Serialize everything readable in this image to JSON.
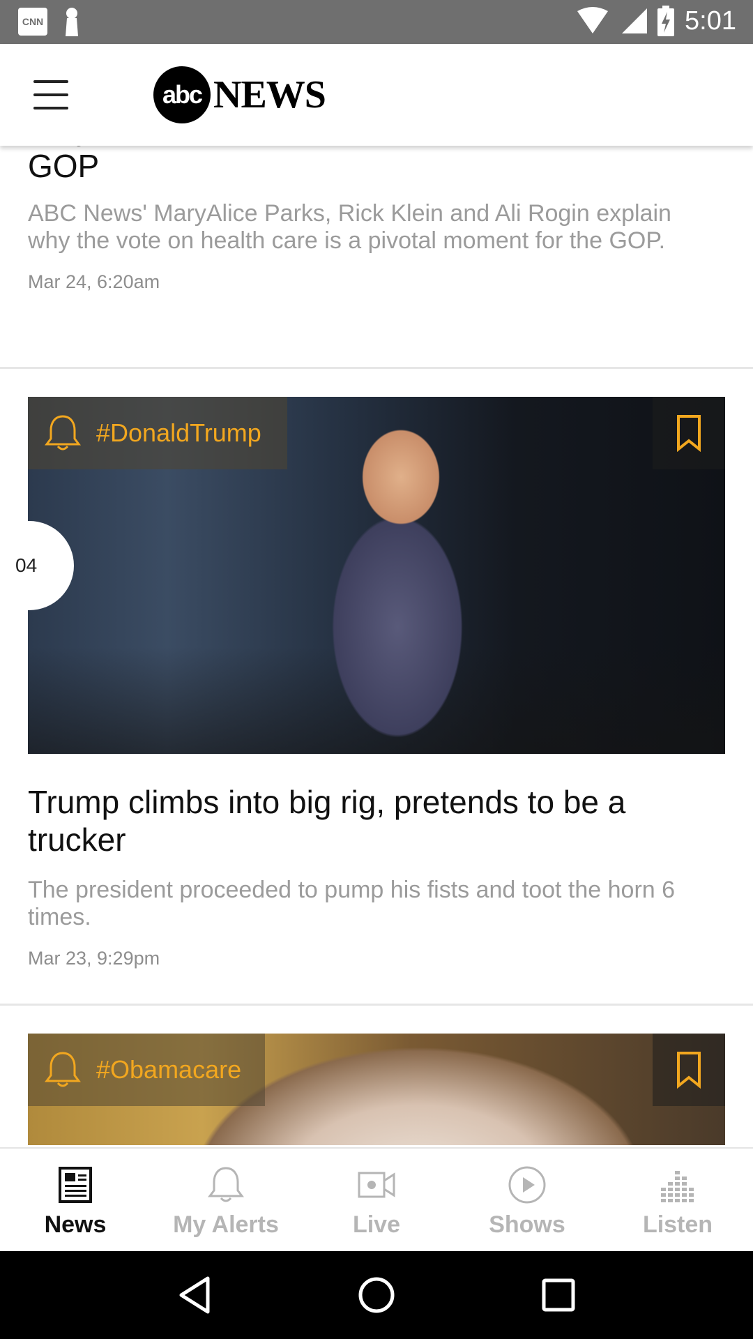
{
  "status_bar": {
    "time": "5:01",
    "notification_badge": "CNN"
  },
  "header": {
    "logo_mark": "abc",
    "logo_text": "NEWS"
  },
  "articles": [
    {
      "headline": "Why the health care vote is crucial for the GOP",
      "summary": "ABC News' MaryAlice Parks, Rick Klein and Ali Rogin explain why the vote on health care is a pivotal moment for the GOP.",
      "timestamp": "Mar 24, 6:20am"
    },
    {
      "tag": "#DonaldTrump",
      "position": "04",
      "headline": "Trump climbs into big rig, pretends to be a trucker",
      "summary": "The president proceeded to pump his fists and toot the horn 6 times.",
      "timestamp": "Mar 23, 9:29pm"
    },
    {
      "tag": "#Obamacare"
    }
  ],
  "bottom_nav": {
    "items": [
      {
        "label": "News",
        "icon": "newspaper-icon",
        "active": true
      },
      {
        "label": "My Alerts",
        "icon": "bell-icon",
        "active": false
      },
      {
        "label": "Live",
        "icon": "video-icon",
        "active": false
      },
      {
        "label": "Shows",
        "icon": "play-icon",
        "active": false
      },
      {
        "label": "Listen",
        "icon": "equalizer-icon",
        "active": false
      }
    ]
  },
  "colors": {
    "accent": "#f2a71f",
    "status_bar": "#6f6f6f",
    "text_primary": "#111111",
    "text_secondary": "#9b9b9b"
  }
}
